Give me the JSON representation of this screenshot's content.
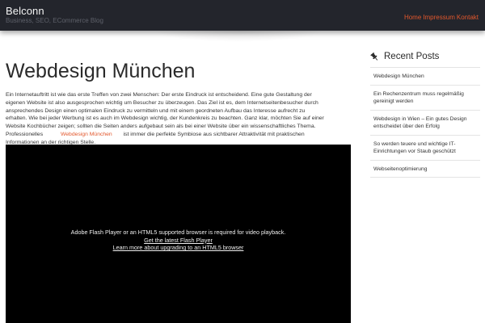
{
  "header": {
    "site_title": "Belconn",
    "tagline": "Business, SEO, ECommerce Blog",
    "nav": [
      "Home",
      "Impressum",
      "Kontakt"
    ]
  },
  "main": {
    "page_title": "Webdesign München",
    "paragraph_before_link": "Ein Internetauftritt ist wie das erste Treffen von zwei Menschen: Der erste Eindruck ist entscheidend. Eine gute Gestaltung der eigenen Website ist also ausgesprochen wichtig um Besucher zu überzeugen. Das Ziel ist es, dem Internetseitenbesucher durch ansprechendes Design einen optimalen Eindruck zu vermitteln und mit einem geordneten Aufbau das Interesse aufrecht zu erhalten. Wie bei jeder Werbung ist es auch im Webdesign wichtig, der Kundenkreis zu beachten. Ganz klar, möchten Sie auf einer Website Kochbücher zeigen; sollten die Seiten anders aufgebaut sein als bei einer Website über ein wissenschaftliches Thema. Professionelles",
    "link_text": "Webdesign München",
    "paragraph_after_link": "ist immer die perfekte Symbiose aus sichtbarer Attraktivität mit praktischen Informationen an der richtigen Stelle.",
    "video": {
      "message": "Adobe Flash Player or an HTML5 supported browser is required for video playback.",
      "link_flash": "Get the latest Flash Player",
      "link_html5": "Learn more about upgrading to an HTML5 browser"
    }
  },
  "sidebar": {
    "widget_title": "Recent Posts",
    "widget_icon": "thumbtack-icon",
    "posts": [
      "Webdesign München",
      "Ein Rechenzentrum muss regelmäßig gereinigt werden",
      "Webdesign in Wien – Ein gutes Design entscheidet über den Erfolg",
      "So werden teuere und wichtige IT-Einrichtungen vor Staub geschützt",
      "Webseitenoptimierung"
    ]
  },
  "colors": {
    "header_bg": "#23252c",
    "accent": "#e2572c",
    "video_bg": "#000000"
  }
}
